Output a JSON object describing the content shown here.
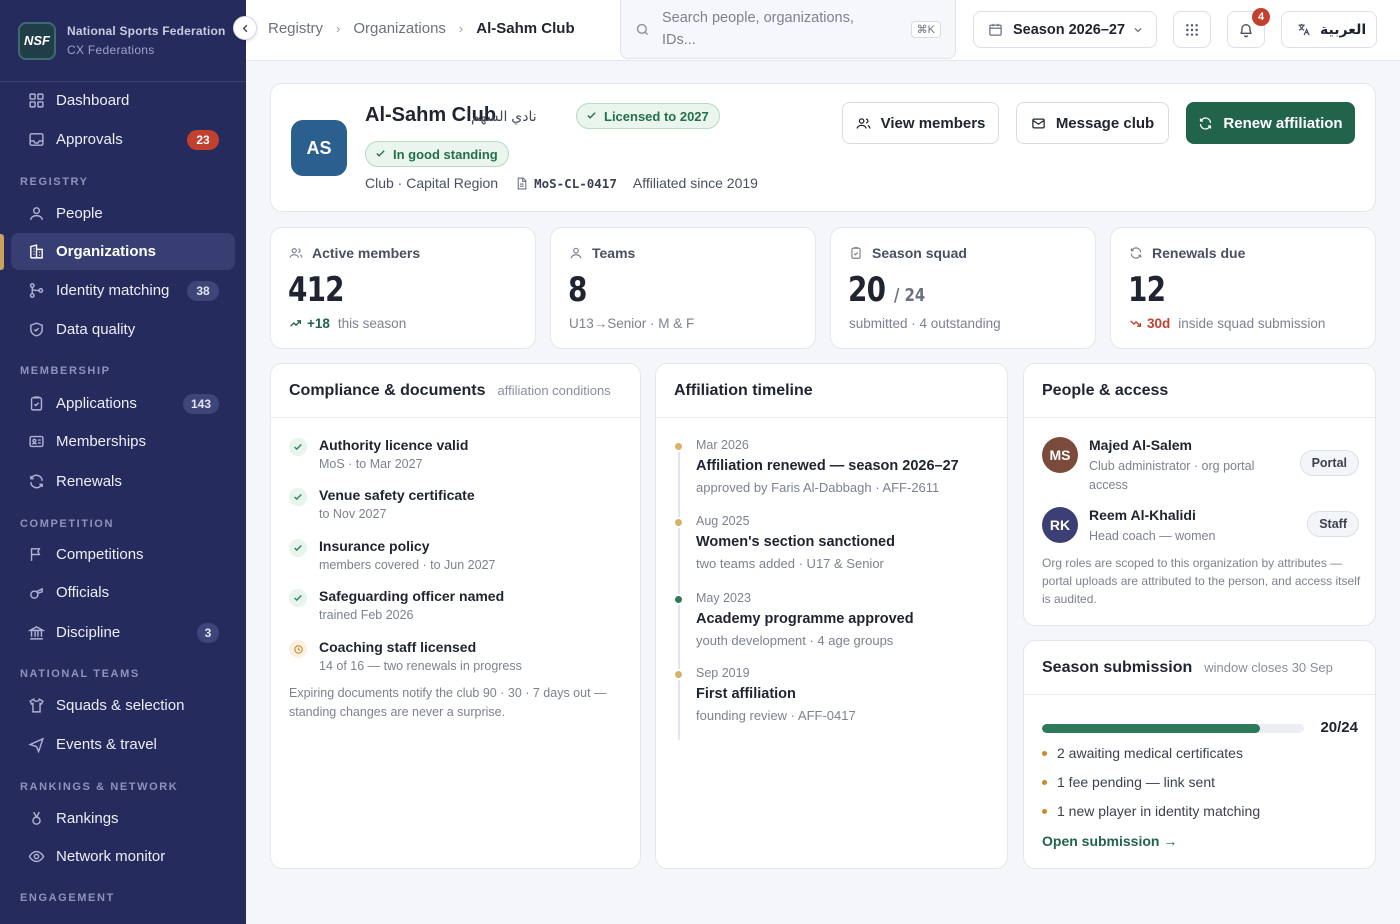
{
  "brand": {
    "logo": "NSF",
    "name": "National Sports Federation",
    "sub": "CX Federations"
  },
  "nav": {
    "dashboard": "Dashboard",
    "approvals": "Approvals",
    "approvals_badge": "23",
    "registry": "REGISTRY",
    "people": "People",
    "organizations": "Organizations",
    "identity": "Identity matching",
    "identity_badge": "38",
    "data_quality": "Data quality",
    "membership": "MEMBERSHIP",
    "applications": "Applications",
    "applications_badge": "143",
    "memberships": "Memberships",
    "renewals": "Renewals",
    "competition": "COMPETITION",
    "competitions": "Competitions",
    "officials": "Officials",
    "discipline": "Discipline",
    "discipline_badge": "3",
    "national_teams": "NATIONAL TEAMS",
    "squads": "Squads & selection",
    "events": "Events & travel",
    "rankings_network": "RANKINGS & NETWORK",
    "rankings": "Rankings",
    "network": "Network monitor",
    "engagement": "ENGAGEMENT"
  },
  "topbar": {
    "crumbs": [
      "Registry",
      "Organizations",
      "Al-Sahm Club"
    ],
    "search_placeholder": "Search people, organizations, IDs...",
    "search_kbd": "⌘K",
    "season": "Season 2026–27",
    "notif_count": "4",
    "lang": "العربية"
  },
  "org": {
    "initials": "AS",
    "name": "Al-Sahm Club",
    "name_ar": "نادي السهم",
    "licence_pill": "Licensed to 2027",
    "standing_pill": "In good standing",
    "type_region": "Club · Capital Region",
    "code": "MoS-CL-0417",
    "affiliated": "Affiliated since 2019",
    "btn_members": "View members",
    "btn_message": "Message club",
    "btn_renew": "Renew affiliation"
  },
  "stats": [
    {
      "title": "Active members",
      "value": "412",
      "of": "",
      "delta": "+18",
      "sub": "this season"
    },
    {
      "title": "Teams",
      "value": "8",
      "of": "",
      "delta": "",
      "sub": "U13→Senior · M & F"
    },
    {
      "title": "Season squad",
      "value": "20",
      "of": "/ 24",
      "delta": "",
      "sub": "submitted · 4 outstanding"
    },
    {
      "title": "Renewals due",
      "value": "12",
      "of": "",
      "delta": "30d",
      "sub": "inside squad submission"
    }
  ],
  "compliance": {
    "title": "Compliance & documents",
    "hint": "affiliation conditions",
    "items": [
      {
        "title": "Authority licence valid",
        "sub": "MoS · to Mar 2027"
      },
      {
        "title": "Venue safety certificate",
        "sub": "to Nov 2027"
      },
      {
        "title": "Insurance policy",
        "sub": "members covered · to Jun 2027"
      },
      {
        "title": "Safeguarding officer named",
        "sub": "trained Feb 2026"
      },
      {
        "title": "Coaching staff licensed",
        "sub": "14 of 16 — two renewals in progress"
      }
    ],
    "note": "Expiring documents notify the club 90 · 30 · 7 days out — standing changes are never a surprise."
  },
  "timeline": {
    "title": "Affiliation timeline",
    "items": [
      {
        "date": "Mar 2026",
        "title": "Affiliation renewed — season 2026–27",
        "sub": "approved by Faris Al-Dabbagh · AFF-2611"
      },
      {
        "date": "Aug 2025",
        "title": "Women's section sanctioned",
        "sub": "two teams added · U17 & Senior"
      },
      {
        "date": "May 2023",
        "title": "Academy programme approved",
        "sub": "youth development · 4 age groups"
      },
      {
        "date": "Sep 2019",
        "title": "First affiliation",
        "sub": "founding review · AFF-0417"
      }
    ]
  },
  "people": {
    "title": "People & access",
    "items": [
      {
        "initials": "MS",
        "name": "Majed Al-Salem",
        "role": "Club administrator · org portal access",
        "tag": "Portal",
        "color": "#7a4a3a"
      },
      {
        "initials": "RK",
        "name": "Reem Al-Khalidi",
        "role": "Head coach — women",
        "tag": "Staff",
        "color": "#3b3f73"
      }
    ],
    "note": "Org roles are scoped to this organization by attributes — portal uploads are attributed to the person, and access itself is audited."
  },
  "submission": {
    "title": "Season submission",
    "hint": "window closes 30 Sep",
    "progress_label": "20/24",
    "progress_fraction": 0.833,
    "bullets": [
      "2 awaiting medical certificates",
      "1 fee pending — link sent",
      "1 new player in identity matching"
    ],
    "link": "Open submission →"
  },
  "colors": {
    "sidebar": "#252b5c",
    "accent_green": "#22634b",
    "badge_red": "#c2412e",
    "gold": "#c9a35b"
  }
}
